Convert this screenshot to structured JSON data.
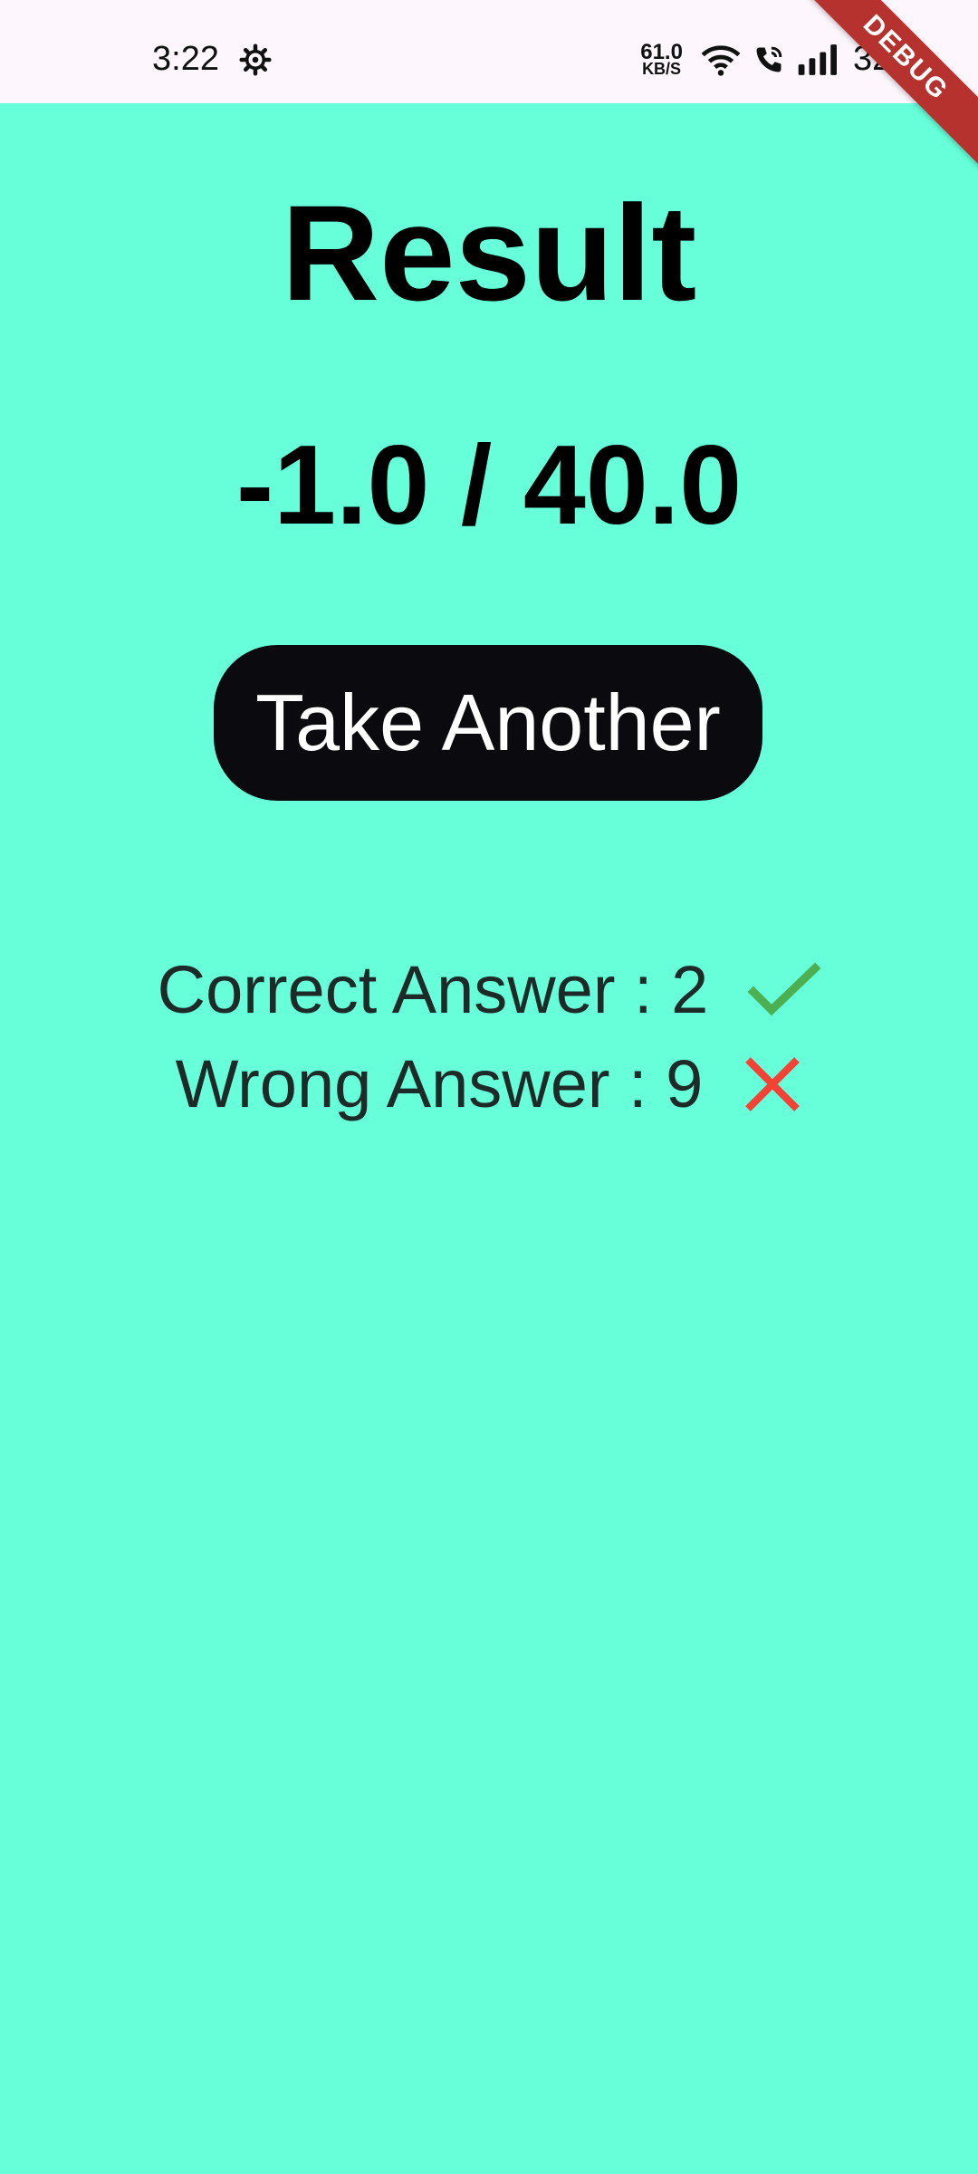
{
  "status_bar": {
    "time": "3:22",
    "net_speed_value": "61.0",
    "net_speed_unit": "KB/S",
    "battery": "32%",
    "icons": [
      "settings-gear-icon",
      "wifi-icon",
      "wifi-calling-icon",
      "signal-icon"
    ]
  },
  "debug_banner": "DEBUG",
  "result": {
    "title": "Result",
    "score": "-1.0 / 40.0",
    "take_another_label": "Take Another",
    "correct_label": "Correct Answer : 2",
    "wrong_label": "Wrong Answer : 9"
  },
  "colors": {
    "background": "#66FFDA",
    "status_bar": "#FDF6FC",
    "button": "#0B0A0F",
    "check": "#4CAF50",
    "cross": "#F44336",
    "debug": "#B5322E"
  }
}
